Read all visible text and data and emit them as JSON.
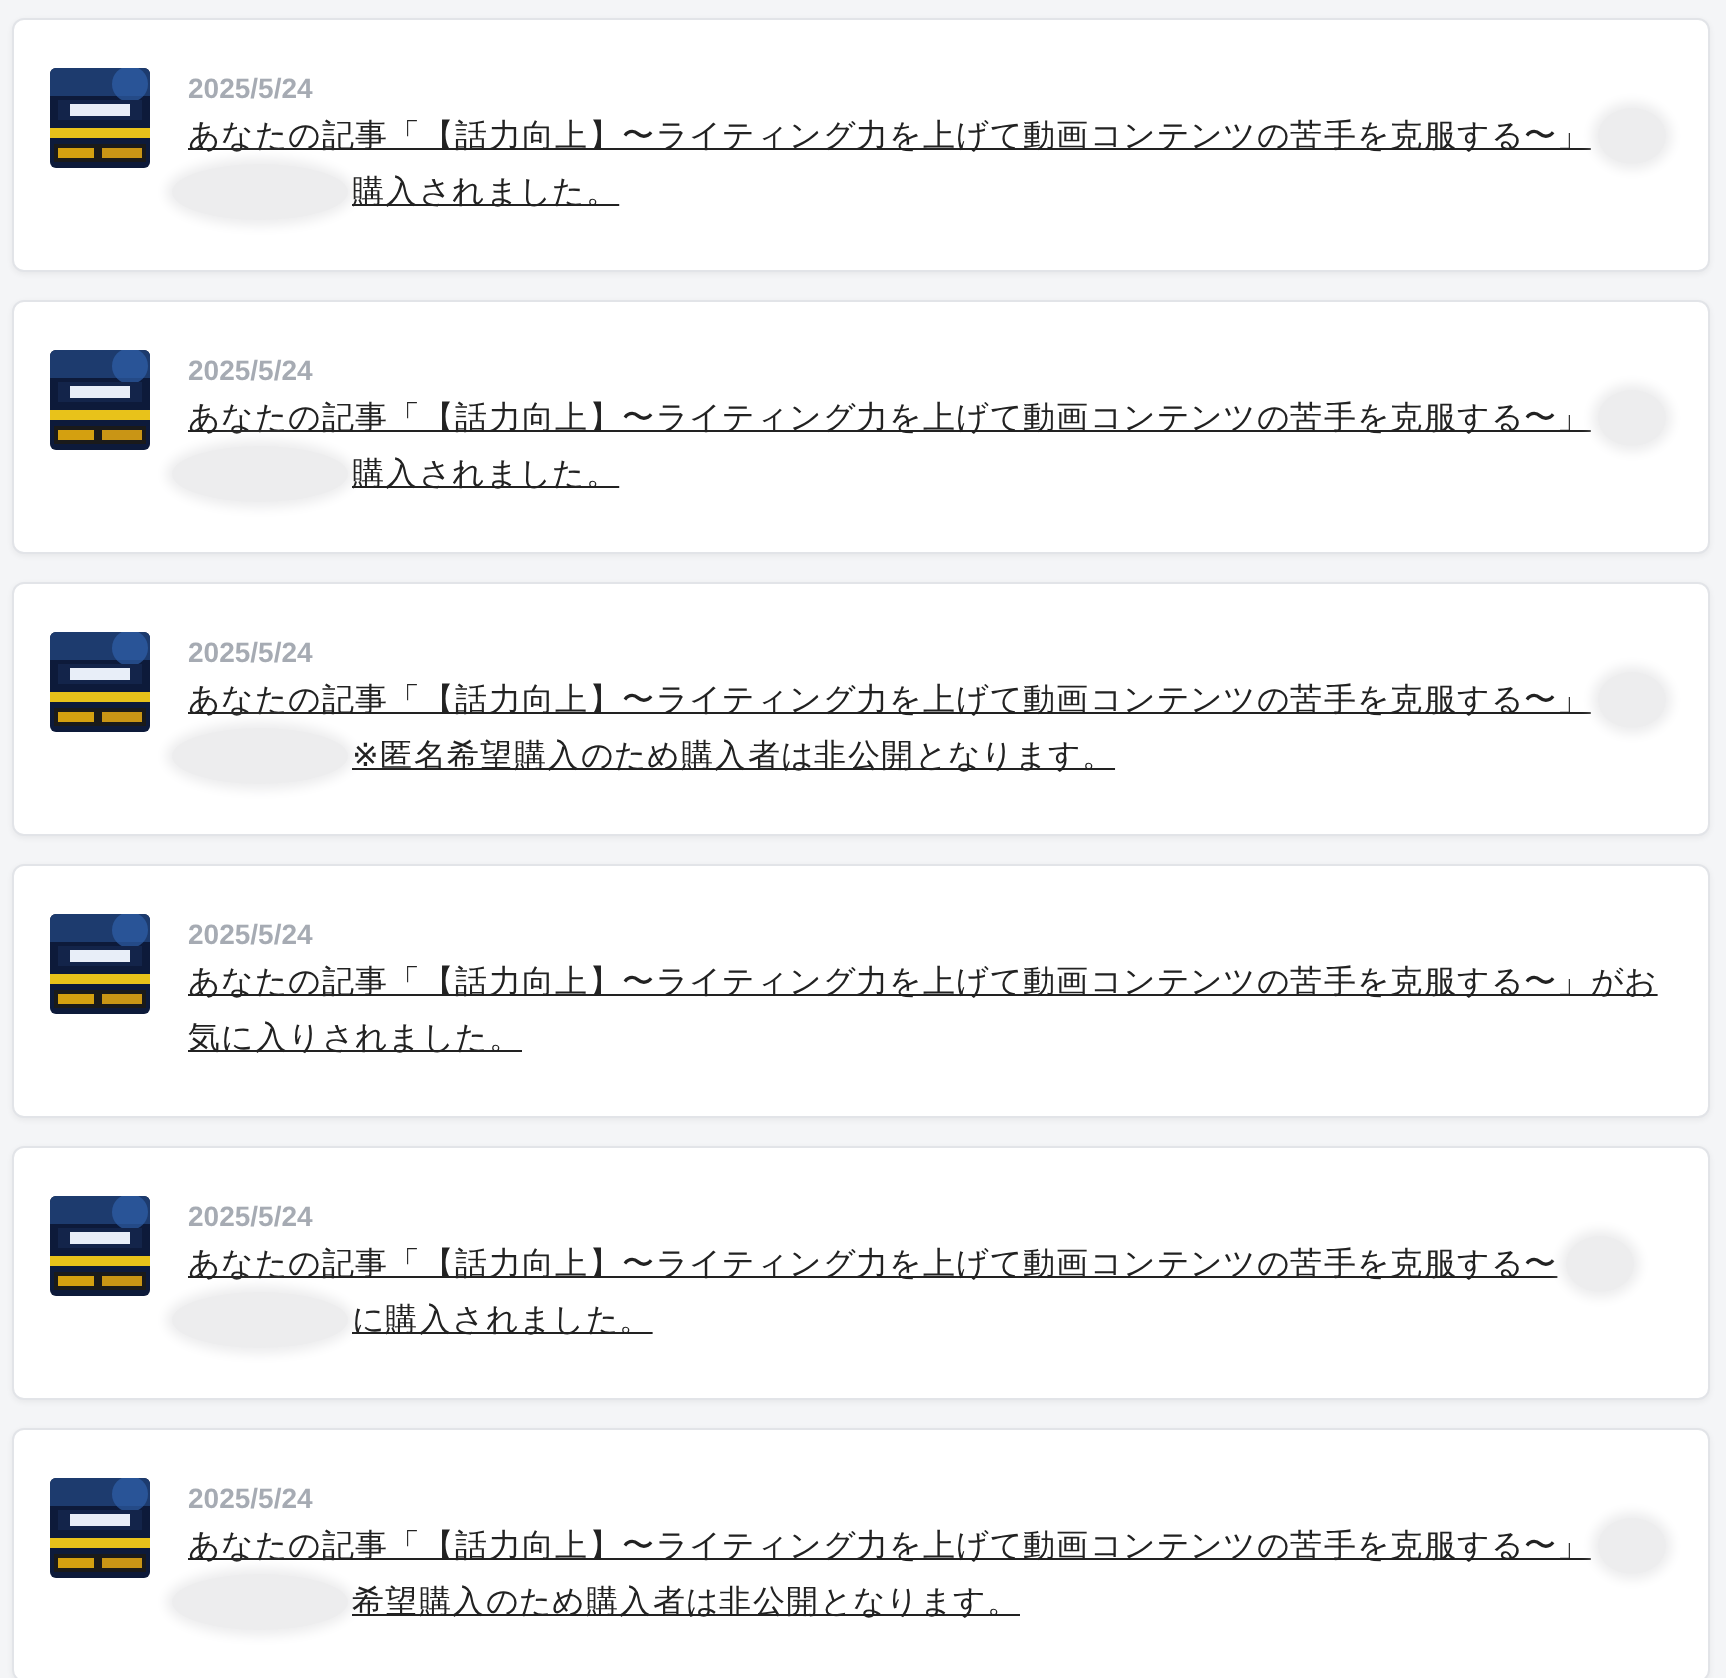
{
  "notifications": [
    {
      "date": "2025/5/24",
      "lines": [
        {
          "text": "あなたの記事「【話力向上】〜ライティング力を上げて動画コンテンツの苦手を克服する〜」",
          "blurred_before": false,
          "blurred_after": true
        },
        {
          "text": "購入されました。",
          "blurred_before": true,
          "blurred_after": false
        }
      ]
    },
    {
      "date": "2025/5/24",
      "lines": [
        {
          "text": "あなたの記事「【話力向上】〜ライティング力を上げて動画コンテンツの苦手を克服する〜」",
          "blurred_before": false,
          "blurred_after": true
        },
        {
          "text": "購入されました。",
          "blurred_before": true,
          "blurred_after": false
        }
      ]
    },
    {
      "date": "2025/5/24",
      "lines": [
        {
          "text": "あなたの記事「【話力向上】〜ライティング力を上げて動画コンテンツの苦手を克服する〜」",
          "blurred_before": false,
          "blurred_after": true
        },
        {
          "text": "※匿名希望購入のため購入者は非公開となります。",
          "blurred_before": true,
          "blurred_after": false
        }
      ]
    },
    {
      "date": "2025/5/24",
      "lines": [
        {
          "text": "あなたの記事「【話力向上】〜ライティング力を上げて動画コンテンツの苦手を克服する〜」がお",
          "blurred_before": false,
          "blurred_after": false
        },
        {
          "text": "気に入りされました。",
          "blurred_before": false,
          "blurred_after": false
        }
      ]
    },
    {
      "date": "2025/5/24",
      "lines": [
        {
          "text": "あなたの記事「【話力向上】〜ライティング力を上げて動画コンテンツの苦手を克服する〜",
          "blurred_before": false,
          "blurred_after": true
        },
        {
          "text": "に購入されました。",
          "blurred_before": true,
          "blurred_after": false
        }
      ]
    },
    {
      "date": "2025/5/24",
      "lines": [
        {
          "text": "あなたの記事「【話力向上】〜ライティング力を上げて動画コンテンツの苦手を克服する〜」",
          "blurred_before": false,
          "blurred_after": true
        },
        {
          "text": "希望購入のため購入者は非公開となります。",
          "blurred_before": true,
          "blurred_after": false
        }
      ]
    }
  ]
}
